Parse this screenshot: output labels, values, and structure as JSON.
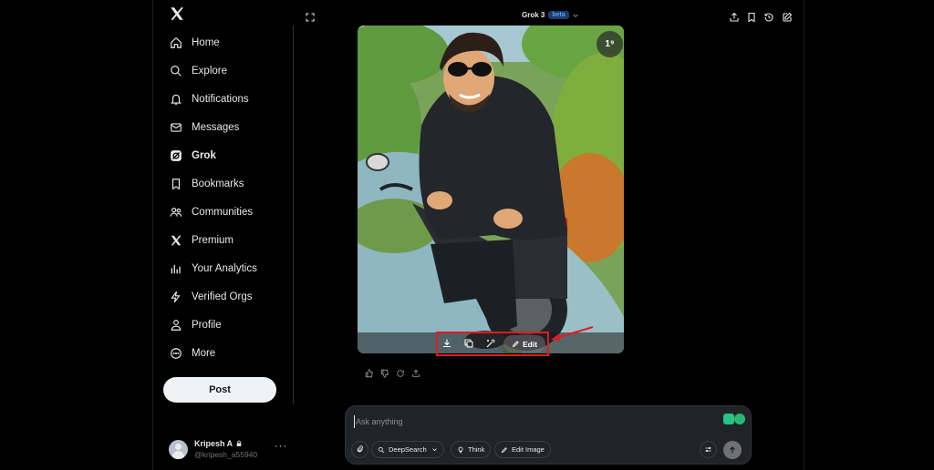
{
  "sidebar": {
    "logo_icon": "x-logo-icon",
    "items": [
      {
        "label": "Home",
        "icon": "home-icon"
      },
      {
        "label": "Explore",
        "icon": "search-icon"
      },
      {
        "label": "Notifications",
        "icon": "bell-icon"
      },
      {
        "label": "Messages",
        "icon": "envelope-icon"
      },
      {
        "label": "Grok",
        "icon": "grok-icon",
        "active": true
      },
      {
        "label": "Bookmarks",
        "icon": "bookmark-icon"
      },
      {
        "label": "Communities",
        "icon": "people-icon"
      },
      {
        "label": "Premium",
        "icon": "x-logo-icon"
      },
      {
        "label": "Your Analytics",
        "icon": "bar-chart-icon"
      },
      {
        "label": "Verified Orgs",
        "icon": "lightning-icon"
      },
      {
        "label": "Profile",
        "icon": "person-icon"
      },
      {
        "label": "More",
        "icon": "more-circle-icon"
      }
    ],
    "post_label": "Post",
    "account": {
      "name": "Kripesh A",
      "handle": "@kripesh_a55940",
      "lock_icon": "lock-icon",
      "more": "···"
    }
  },
  "header": {
    "title": "Grok 3",
    "badge": "beta",
    "icons": [
      "expand-icon",
      "share-icon",
      "bookmark-icon",
      "history-icon",
      "new-chat-icon"
    ]
  },
  "image": {
    "counter": "1⁹",
    "toolbar": {
      "icons": [
        "download-icon",
        "copy-icon",
        "redraw-icon"
      ],
      "edit_label": "Edit"
    },
    "annotation_color": "#e01b24"
  },
  "feedback_icons": [
    "thumbs-up-icon",
    "thumbs-down-icon",
    "regenerate-icon",
    "share-icon"
  ],
  "composer": {
    "placeholder": "Ask anything",
    "chips": {
      "deepsearch": "DeepSearch",
      "think": "Think",
      "edit_image": "Edit Image"
    }
  },
  "colors": {
    "background": "#000000",
    "accent_blue": "#4ea1ff",
    "post_button": "#eff3f4",
    "composer": "#202327"
  }
}
